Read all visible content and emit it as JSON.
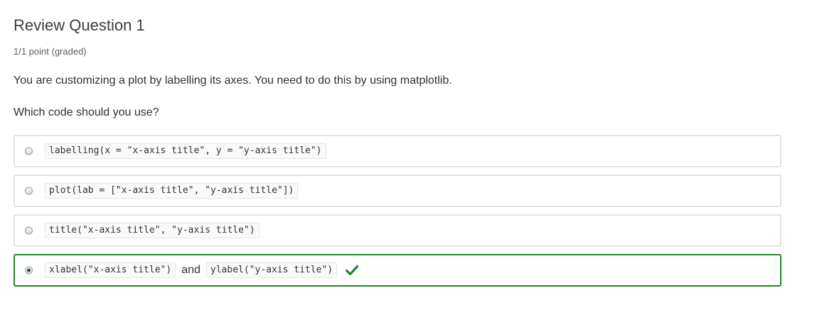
{
  "question": {
    "title": "Review Question 1",
    "grade": "1/1 point (graded)",
    "prompt": "You are customizing a plot by labelling its axes. You need to do this by using matplotlib.",
    "subprompt": "Which code should you use?"
  },
  "choices": [
    {
      "code": "labelling(x = \"x-axis title\", y = \"y-axis title\")",
      "selected": false
    },
    {
      "code": "plot(lab = [\"x-axis title\", \"y-axis title\"])",
      "selected": false
    },
    {
      "code": "title(\"x-axis title\", \"y-axis title\")",
      "selected": false
    },
    {
      "code": "xlabel(\"x-axis title\")",
      "joiner": "and",
      "code2": "ylabel(\"y-axis title\")",
      "selected": true,
      "status": "correct"
    }
  ],
  "colors": {
    "correct": "#1e8a1e",
    "border": "#e3e3e3"
  },
  "icons": {
    "status": "check-icon"
  }
}
